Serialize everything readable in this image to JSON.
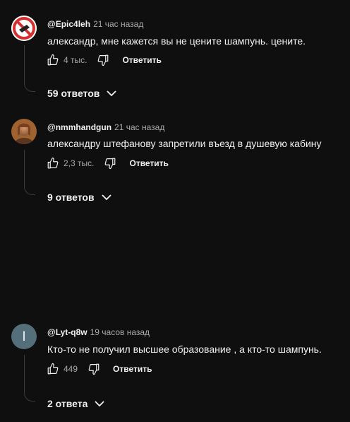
{
  "comments": [
    {
      "author": "@Epic4leh",
      "time": "21 час назад",
      "text": "александр, мне кажется вы не цените шампунь. цените.",
      "likes": "4 тыс.",
      "reply_label": "Ответить",
      "replies_label": "59 ответов",
      "avatar_icon": "no-symbol-avatar"
    },
    {
      "author": "@nmmhandgun",
      "time": "21 час назад",
      "text": "александру штефанову запретили въезд в душевую кабину",
      "likes": "2,3 тыс.",
      "reply_label": "Ответить",
      "replies_label": "9 ответов",
      "avatar_icon": "photo-avatar"
    },
    {
      "author": "@Lyt-q8w",
      "time": "19 часов назад",
      "text": "Кто-то не получил высшее образование , а кто-то шампунь.",
      "likes": "449",
      "reply_label": "Ответить",
      "replies_label": "2 ответа",
      "avatar_letter": "l",
      "avatar_color": "#546e7a"
    }
  ]
}
